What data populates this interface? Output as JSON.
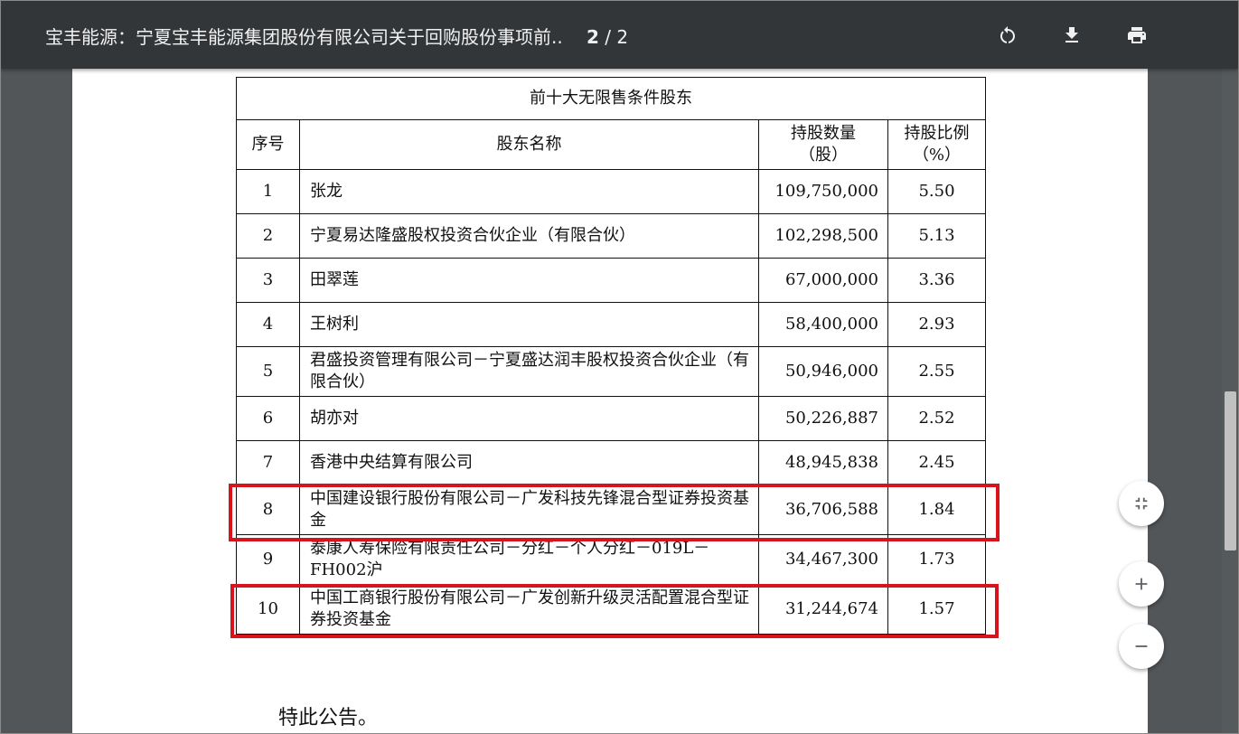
{
  "toolbar": {
    "title": "宝丰能源：宁夏宝丰能源集团股份有限公司关于回购股份事项前..",
    "current_page": "2",
    "page_separator": "/",
    "total_pages": "2",
    "icons": [
      "rotate-icon",
      "download-icon",
      "print-icon"
    ]
  },
  "table": {
    "title": "前十大无限售条件股东",
    "headers": {
      "index": "序号",
      "name": "股东名称",
      "shares_l1": "持股数量",
      "shares_l2": "（股）",
      "ratio_l1": "持股比例",
      "ratio_l2": "（%）"
    },
    "rows": [
      {
        "index": "1",
        "name": "张龙",
        "shares": "109,750,000",
        "ratio": "5.50"
      },
      {
        "index": "2",
        "name": "宁夏易达隆盛股权投资合伙企业（有限合伙）",
        "shares": "102,298,500",
        "ratio": "5.13"
      },
      {
        "index": "3",
        "name": "田翠莲",
        "shares": "67,000,000",
        "ratio": "3.36"
      },
      {
        "index": "4",
        "name": "王树利",
        "shares": "58,400,000",
        "ratio": "2.93"
      },
      {
        "index": "5",
        "name": "君盛投资管理有限公司－宁夏盛达润丰股权投资合伙企业（有限合伙）",
        "shares": "50,946,000",
        "ratio": "2.55"
      },
      {
        "index": "6",
        "name": "胡亦对",
        "shares": "50,226,887",
        "ratio": "2.52"
      },
      {
        "index": "7",
        "name": "香港中央结算有限公司",
        "shares": "48,945,838",
        "ratio": "2.45"
      },
      {
        "index": "8",
        "name": "中国建设银行股份有限公司－广发科技先锋混合型证券投资基金",
        "shares": "36,706,588",
        "ratio": "1.84"
      },
      {
        "index": "9",
        "name": "泰康人寿保险有限责任公司－分红－个人分红－019L－FH002沪",
        "shares": "34,467,300",
        "ratio": "1.73"
      },
      {
        "index": "10",
        "name": "中国工商银行股份有限公司－广发创新升级灵活配置混合型证券投资基金",
        "shares": "31,244,674",
        "ratio": "1.57"
      }
    ]
  },
  "closing_text": "特此公告。",
  "zoom_controls": {
    "icons": [
      "fit-page-icon",
      "zoom-in-icon",
      "zoom-out-icon"
    ]
  },
  "colors": {
    "toolbar_bg": "#323639",
    "viewer_bg": "#525659",
    "highlight": "#d6141e"
  }
}
